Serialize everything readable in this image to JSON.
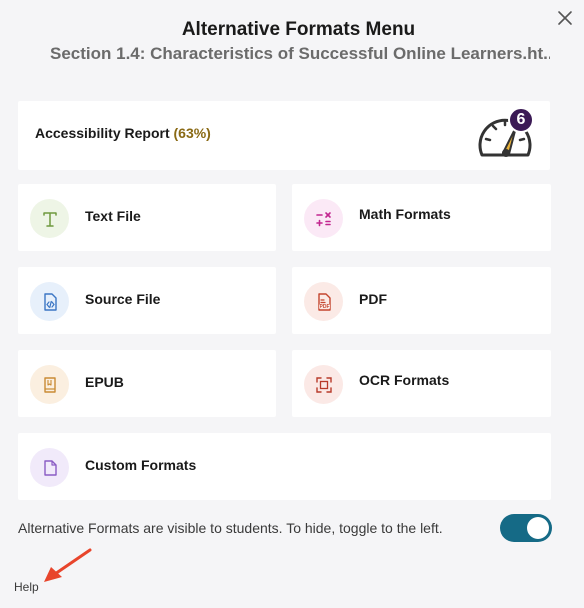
{
  "dialog": {
    "title": "Alternative Formats Menu",
    "subtitle": "Section 1.4: Characteristics of Successful Online Learners.ht..."
  },
  "report": {
    "label": "Accessibility Report",
    "percent": "(63%)",
    "badge_count": "6",
    "score_value": 63,
    "accent_color": "#8a6a15",
    "gauge_needle_color": "#e8b23a",
    "badge_color": "#3b1a55"
  },
  "formats": [
    {
      "label": "Text File",
      "icon": "text-file-icon",
      "bg": "#eef5e6",
      "color": "#6f9a3e"
    },
    {
      "label": "Math Formats",
      "icon": "math-icon",
      "bg": "#fbe9f6",
      "color": "#c2268f"
    },
    {
      "label": "Source File",
      "icon": "source-file-icon",
      "bg": "#e7f0fb",
      "color": "#3b76c4"
    },
    {
      "label": "PDF",
      "icon": "pdf-icon",
      "bg": "#fbeae6",
      "color": "#c4452e"
    },
    {
      "label": "EPUB",
      "icon": "epub-icon",
      "bg": "#fbefe0",
      "color": "#c98b34"
    },
    {
      "label": "OCR Formats",
      "icon": "ocr-icon",
      "bg": "#fbe9e6",
      "color": "#b83a2a"
    },
    {
      "label": "Custom Formats",
      "icon": "custom-format-icon",
      "bg": "#f1eafa",
      "color": "#8a5cc4"
    }
  ],
  "visibility": {
    "text": "Alternative Formats are visible to students. To hide, toggle to the left.",
    "enabled": true,
    "toggle_color": "#156a86"
  },
  "footer": {
    "help_label": "Help",
    "annotation_arrow_color": "#e8452c"
  }
}
